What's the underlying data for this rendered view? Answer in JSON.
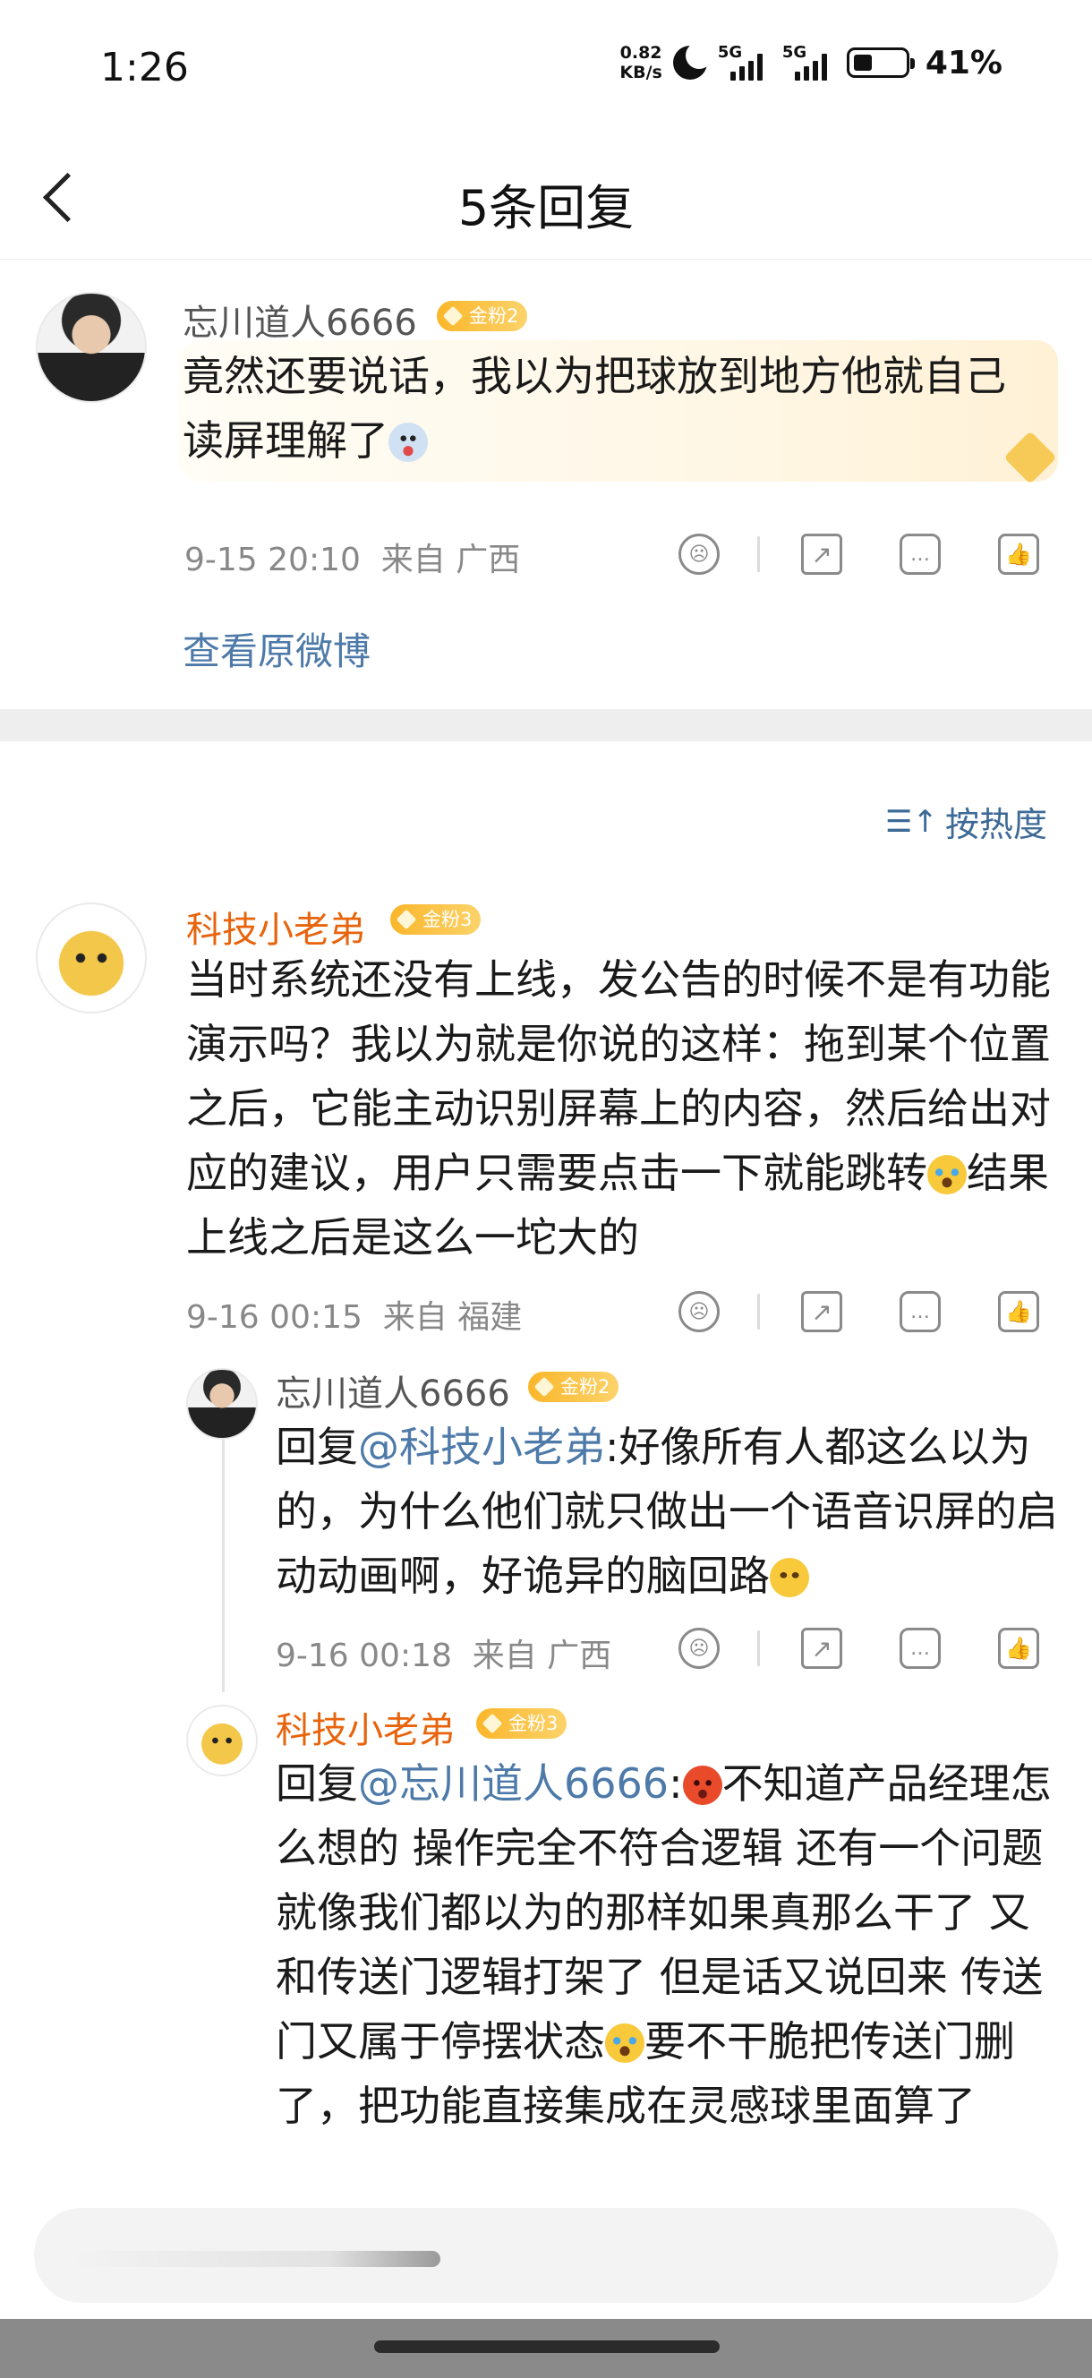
{
  "status_bar": {
    "time": "1:26",
    "net_speed_value": "0.82",
    "net_speed_unit": "KB/s",
    "signal1": "5G",
    "signal2": "5G",
    "battery_pct": "41%"
  },
  "nav": {
    "title": "5条回复"
  },
  "original": {
    "user": "忘川道人6666",
    "badge": "金粉2",
    "text": "竟然还要说话，我以为把球放到地方他就自己读屏理解了",
    "timestamp": "9-15 20:10",
    "source": "来自 广西",
    "view_original": "查看原微博"
  },
  "sort": {
    "label": "按热度",
    "icon": "sort-icon"
  },
  "comment": {
    "user": "科技小老弟",
    "badge": "金粉3",
    "text_a": "当时系统还没有上线，发公告的时候不是有功能演示吗？我以为就是你说的这样：拖到某个位置之后，它能主动识别屏幕上的内容，然后给出对应的建议，用户只需要点击一下就能跳转",
    "text_b": "结果上线之后是这么一坨大的",
    "timestamp": "9-16 00:15",
    "source": "来自 福建"
  },
  "replies": [
    {
      "user": "忘川道人6666",
      "badge": "金粉2",
      "prefix": "回复",
      "mention": "@科技小老弟",
      "text": ":好像所有人都这么以为的，为什么他们就只做出一个语音识屏的启动动画啊，好诡异的脑回路",
      "timestamp": "9-16 00:18",
      "source": "来自 广西"
    },
    {
      "user": "科技小老弟",
      "badge": "金粉3",
      "prefix": "回复",
      "mention": "@忘川道人6666",
      "text_a": ":",
      "text_b": "不知道产品经理怎么想的 操作完全不符合逻辑  还有一个问题 就像我们都以为的那样如果真那么干了 又和传送门逻辑打架了 但是话又说回来 传送门又属于停摆状态",
      "text_c": "要不干脆把传送门删了，把功能直接集成在灵感球里面算了"
    }
  ],
  "icons": [
    "back-icon",
    "emoji-icon",
    "share-icon",
    "comment-icon",
    "like-icon"
  ],
  "colors": {
    "accent_orange": "#e8640c",
    "link_blue": "#4d7aa8",
    "badge_gold": "#fbb62a"
  }
}
